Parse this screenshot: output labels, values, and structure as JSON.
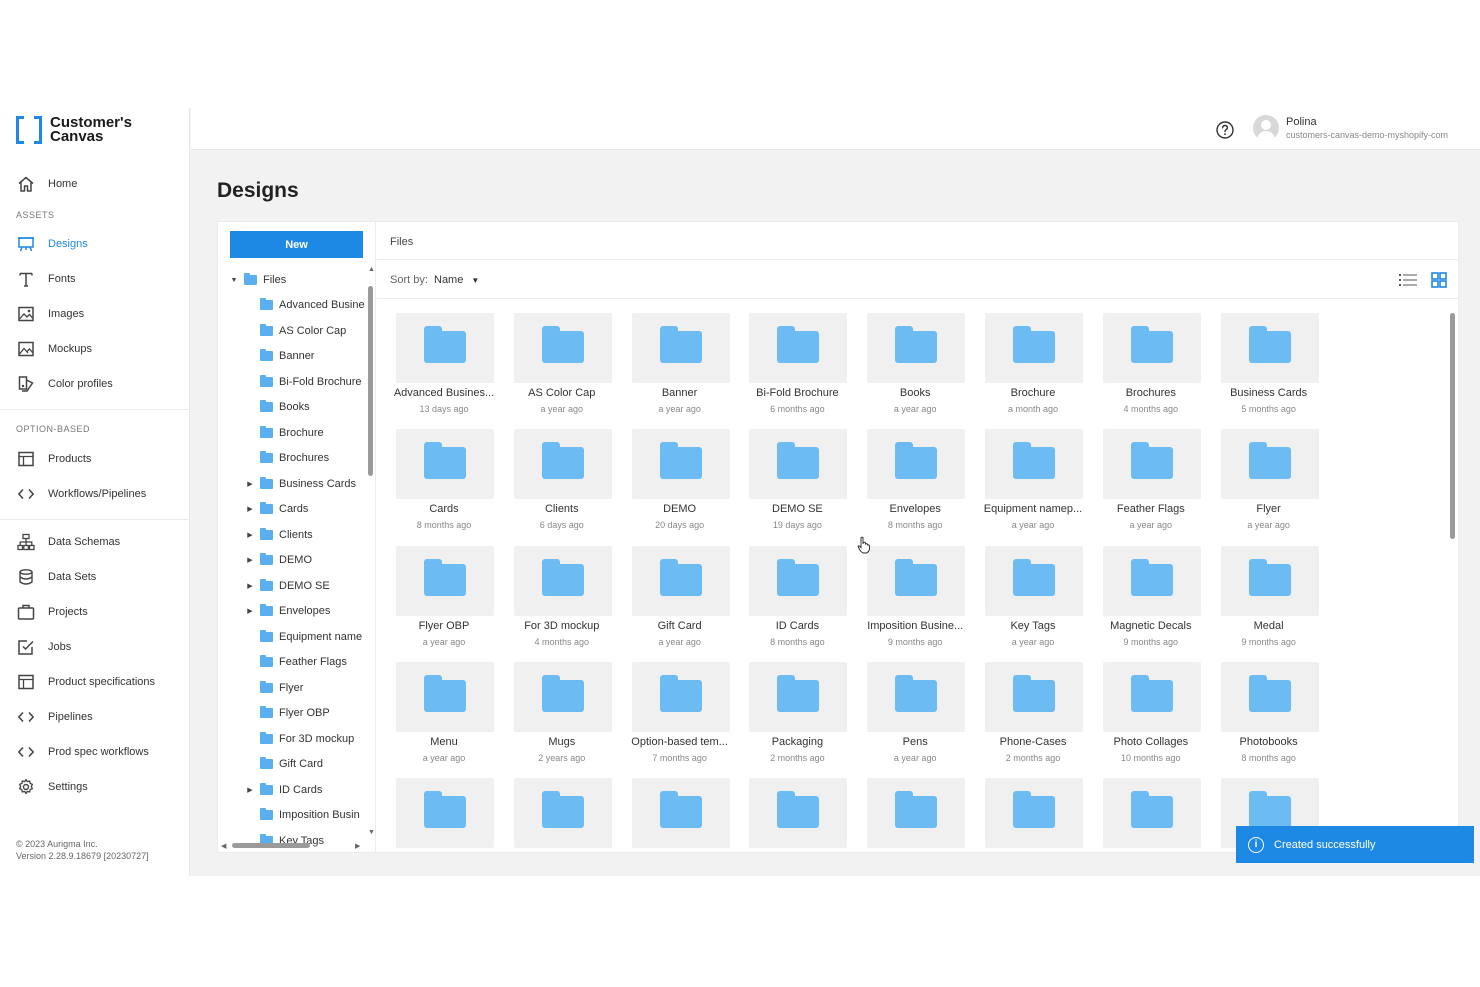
{
  "brand": {
    "name": "Customer's Canvas"
  },
  "sidebar": {
    "home": "Home",
    "sections": {
      "assets": "ASSETS",
      "option_based": "OPTION-BASED"
    },
    "assets": [
      {
        "label": "Designs",
        "icon": "designs-icon",
        "active": true
      },
      {
        "label": "Fonts",
        "icon": "fonts-icon"
      },
      {
        "label": "Images",
        "icon": "images-icon"
      },
      {
        "label": "Mockups",
        "icon": "mockups-icon"
      },
      {
        "label": "Color profiles",
        "icon": "color-profiles-icon"
      }
    ],
    "option_based": [
      {
        "label": "Products",
        "icon": "products-icon"
      },
      {
        "label": "Workflows/Pipelines",
        "icon": "code-icon"
      }
    ],
    "other": [
      {
        "label": "Data Schemas",
        "icon": "data-schemas-icon"
      },
      {
        "label": "Data Sets",
        "icon": "database-icon"
      },
      {
        "label": "Projects",
        "icon": "projects-icon"
      },
      {
        "label": "Jobs",
        "icon": "jobs-icon"
      },
      {
        "label": "Product specifications",
        "icon": "product-specs-icon"
      },
      {
        "label": "Pipelines",
        "icon": "code-icon"
      },
      {
        "label": "Prod spec workflows",
        "icon": "code-icon"
      },
      {
        "label": "Settings",
        "icon": "gear-icon"
      }
    ],
    "copyright": "© 2023 Aurigma Inc.",
    "version": "Version 2.28.9.18679 [20230727]"
  },
  "header": {
    "user_name": "Polina",
    "user_shop": "customers-canvas-demo-myshopify-com"
  },
  "page": {
    "title": "Designs",
    "new_button": "New",
    "breadcrumb": "Files",
    "sort_label": "Sort by:",
    "sort_value": "Name"
  },
  "tree": {
    "root": "Files",
    "items": [
      {
        "label": "Advanced Busine",
        "expandable": false
      },
      {
        "label": "AS Color Cap",
        "expandable": false
      },
      {
        "label": "Banner",
        "expandable": false
      },
      {
        "label": "Bi-Fold Brochure",
        "expandable": false
      },
      {
        "label": "Books",
        "expandable": false
      },
      {
        "label": "Brochure",
        "expandable": false
      },
      {
        "label": "Brochures",
        "expandable": false
      },
      {
        "label": "Business Cards",
        "expandable": true
      },
      {
        "label": "Cards",
        "expandable": true
      },
      {
        "label": "Clients",
        "expandable": true
      },
      {
        "label": "DEMO",
        "expandable": true
      },
      {
        "label": "DEMO SE",
        "expandable": true
      },
      {
        "label": "Envelopes",
        "expandable": true
      },
      {
        "label": "Equipment name",
        "expandable": false
      },
      {
        "label": "Feather Flags",
        "expandable": false
      },
      {
        "label": "Flyer",
        "expandable": false
      },
      {
        "label": "Flyer OBP",
        "expandable": false
      },
      {
        "label": "For 3D mockup",
        "expandable": false
      },
      {
        "label": "Gift Card",
        "expandable": false
      },
      {
        "label": "ID Cards",
        "expandable": true
      },
      {
        "label": "Imposition Busin",
        "expandable": false
      },
      {
        "label": "Key Tags",
        "expandable": false
      }
    ]
  },
  "folders": [
    {
      "name": "Advanced Busines...",
      "date": "13 days ago"
    },
    {
      "name": "AS Color Cap",
      "date": "a year ago"
    },
    {
      "name": "Banner",
      "date": "a year ago"
    },
    {
      "name": "Bi-Fold Brochure",
      "date": "6 months ago"
    },
    {
      "name": "Books",
      "date": "a year ago"
    },
    {
      "name": "Brochure",
      "date": "a month ago"
    },
    {
      "name": "Brochures",
      "date": "4 months ago"
    },
    {
      "name": "Business Cards",
      "date": "5 months ago"
    },
    {
      "name": "Cards",
      "date": "8 months ago"
    },
    {
      "name": "Clients",
      "date": "6 days ago"
    },
    {
      "name": "DEMO",
      "date": "20 days ago"
    },
    {
      "name": "DEMO SE",
      "date": "19 days ago"
    },
    {
      "name": "Envelopes",
      "date": "8 months ago"
    },
    {
      "name": "Equipment namep...",
      "date": "a year ago"
    },
    {
      "name": "Feather Flags",
      "date": "a year ago"
    },
    {
      "name": "Flyer",
      "date": "a year ago"
    },
    {
      "name": "Flyer OBP",
      "date": "a year ago"
    },
    {
      "name": "For 3D mockup",
      "date": "4 months ago"
    },
    {
      "name": "Gift Card",
      "date": "a year ago"
    },
    {
      "name": "ID Cards",
      "date": "8 months ago"
    },
    {
      "name": "Imposition Busine...",
      "date": "9 months ago"
    },
    {
      "name": "Key Tags",
      "date": "a year ago"
    },
    {
      "name": "Magnetic Decals",
      "date": "9 months ago"
    },
    {
      "name": "Medal",
      "date": "9 months ago"
    },
    {
      "name": "Menu",
      "date": "a year ago"
    },
    {
      "name": "Mugs",
      "date": "2 years ago"
    },
    {
      "name": "Option-based tem...",
      "date": "7 months ago"
    },
    {
      "name": "Packaging",
      "date": "2 months ago"
    },
    {
      "name": "Pens",
      "date": "a year ago"
    },
    {
      "name": "Phone-Cases",
      "date": "2 months ago"
    },
    {
      "name": "Photo Collages",
      "date": "10 months ago"
    },
    {
      "name": "Photobooks",
      "date": "8 months ago"
    },
    {
      "name": "",
      "date": ""
    },
    {
      "name": "",
      "date": ""
    },
    {
      "name": "",
      "date": ""
    },
    {
      "name": "",
      "date": ""
    },
    {
      "name": "",
      "date": ""
    },
    {
      "name": "",
      "date": ""
    },
    {
      "name": "",
      "date": ""
    },
    {
      "name": "",
      "date": ""
    }
  ],
  "toast": {
    "message": "Created successfully"
  },
  "colors": {
    "accent": "#1e88e5",
    "folder": "#6cbcf3"
  }
}
